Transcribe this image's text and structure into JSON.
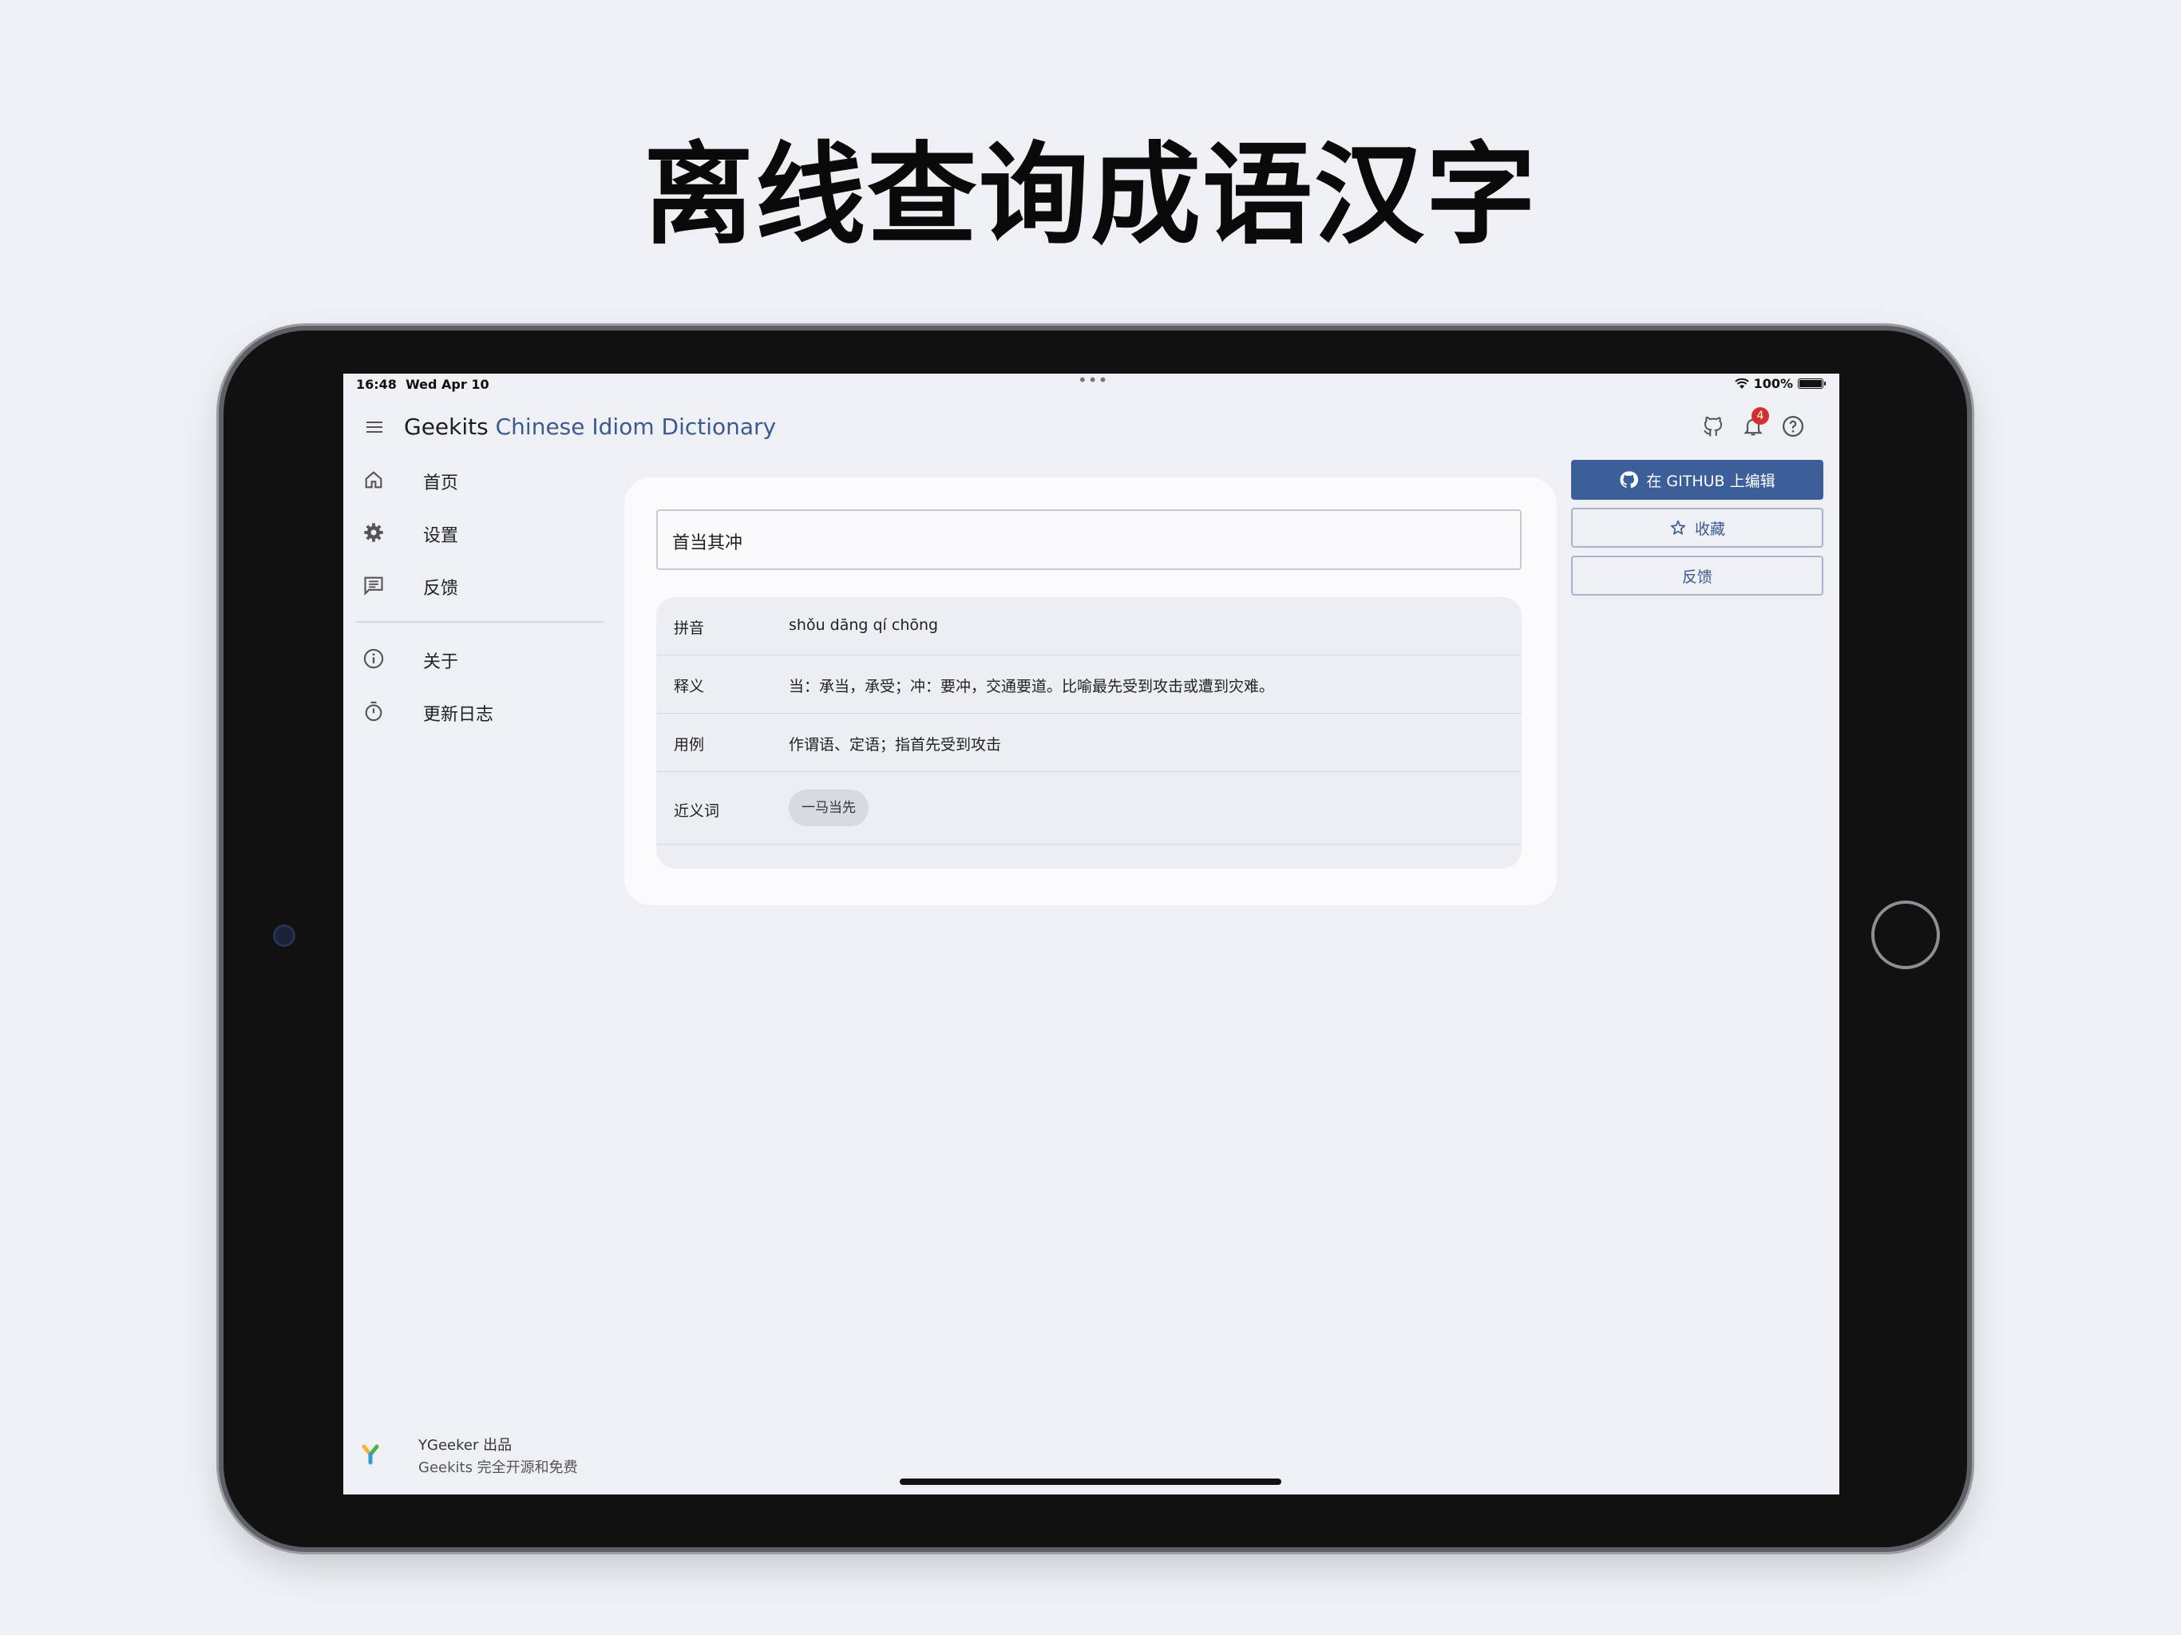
{
  "headline": "离线查询成语汉字",
  "status": {
    "time": "16:48",
    "date": "Wed Apr 10",
    "battery": "100%",
    "battery_level": 1.0
  },
  "app": {
    "brand": "Geekits",
    "title": "Chinese Idiom Dictionary",
    "notification_count": "4"
  },
  "sidebar": {
    "items": [
      {
        "label": "首页",
        "icon": "home-icon"
      },
      {
        "label": "设置",
        "icon": "gear-icon"
      },
      {
        "label": "反馈",
        "icon": "message-icon"
      }
    ],
    "items2": [
      {
        "label": "关于",
        "icon": "info-icon"
      },
      {
        "label": "更新日志",
        "icon": "timer-icon"
      }
    ],
    "footer": {
      "line1": "YGeeker 出品",
      "line2": "Geekits 完全开源和免费"
    }
  },
  "search": {
    "value": "首当其冲"
  },
  "details": {
    "pinyin_label": "拼音",
    "pinyin": "shǒu dāng qí chōng",
    "meaning_label": "释义",
    "meaning": "当：承当，承受；冲：要冲，交通要道。比喻最先受到攻击或遭到灾难。",
    "usage_label": "用例",
    "usage": "作谓语、定语；指首先受到攻击",
    "synonyms_label": "近义词",
    "synonyms": [
      "一马当先"
    ]
  },
  "actions": {
    "github": "在 GITHUB 上编辑",
    "favorite": "收藏",
    "feedback": "反馈"
  },
  "colors": {
    "accent": "#3d5f99",
    "badge": "#d32f2f",
    "background": "#eff0f4"
  }
}
